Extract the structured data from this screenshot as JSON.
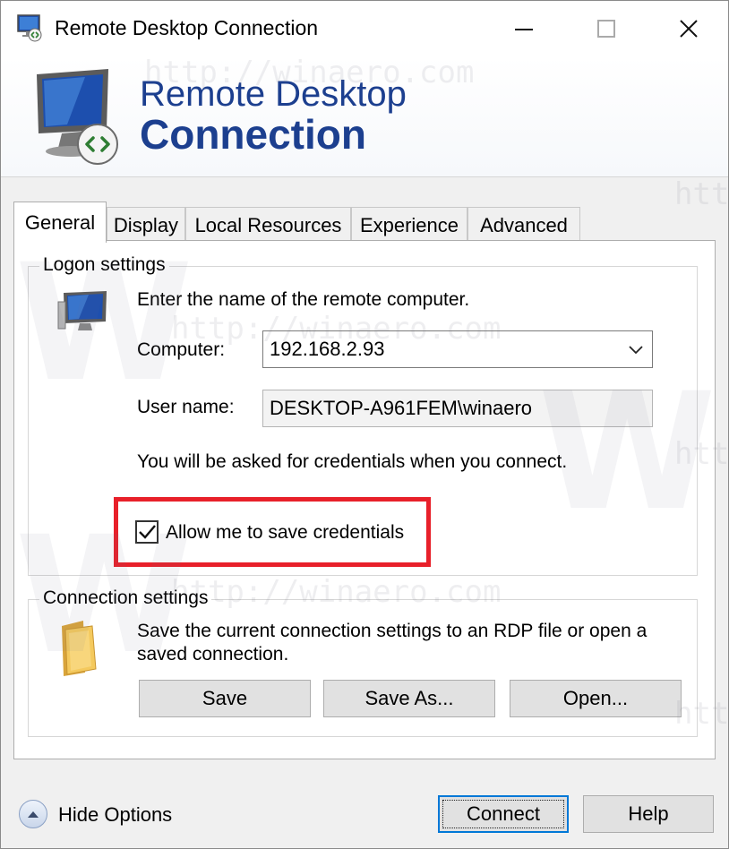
{
  "window": {
    "title": "Remote Desktop Connection",
    "icons": {
      "app": "remote-desktop-icon",
      "minimize": "minimize-icon",
      "maximize": "maximize-icon",
      "close": "close-icon"
    }
  },
  "banner": {
    "line1": "Remote Desktop",
    "line2": "Connection",
    "icon": "remote-desktop-monitor-icon"
  },
  "tabs": [
    {
      "label": "General",
      "active": true
    },
    {
      "label": "Display"
    },
    {
      "label": "Local Resources"
    },
    {
      "label": "Experience"
    },
    {
      "label": "Advanced"
    }
  ],
  "logon": {
    "group_label": "Logon settings",
    "instruction": "Enter the name of the remote computer.",
    "computer_label": "Computer:",
    "computer_value": "192.168.2.93",
    "username_label": "User name:",
    "username_value": "DESKTOP-A961FEM\\winaero",
    "credentials_note": "You will be asked for credentials when you connect.",
    "save_credentials_label": "Allow me to save credentials",
    "save_credentials_checked": true,
    "highlight_color": "#e8202a"
  },
  "connection": {
    "group_label": "Connection settings",
    "description_line1": "Save the current connection settings to an RDP file or open a",
    "description_line2": "saved connection.",
    "save_label": "Save",
    "save_as_label": "Save As...",
    "open_label": "Open..."
  },
  "footer": {
    "hide_options_label": "Hide Options",
    "connect_label": "Connect",
    "help_label": "Help"
  },
  "watermark": {
    "url_text": "http://winaero.com",
    "letter": "W",
    "partial_text": "htt"
  },
  "colors": {
    "accent": "#0078d7",
    "banner_text": "#1c3f8f",
    "highlight": "#e8202a"
  }
}
